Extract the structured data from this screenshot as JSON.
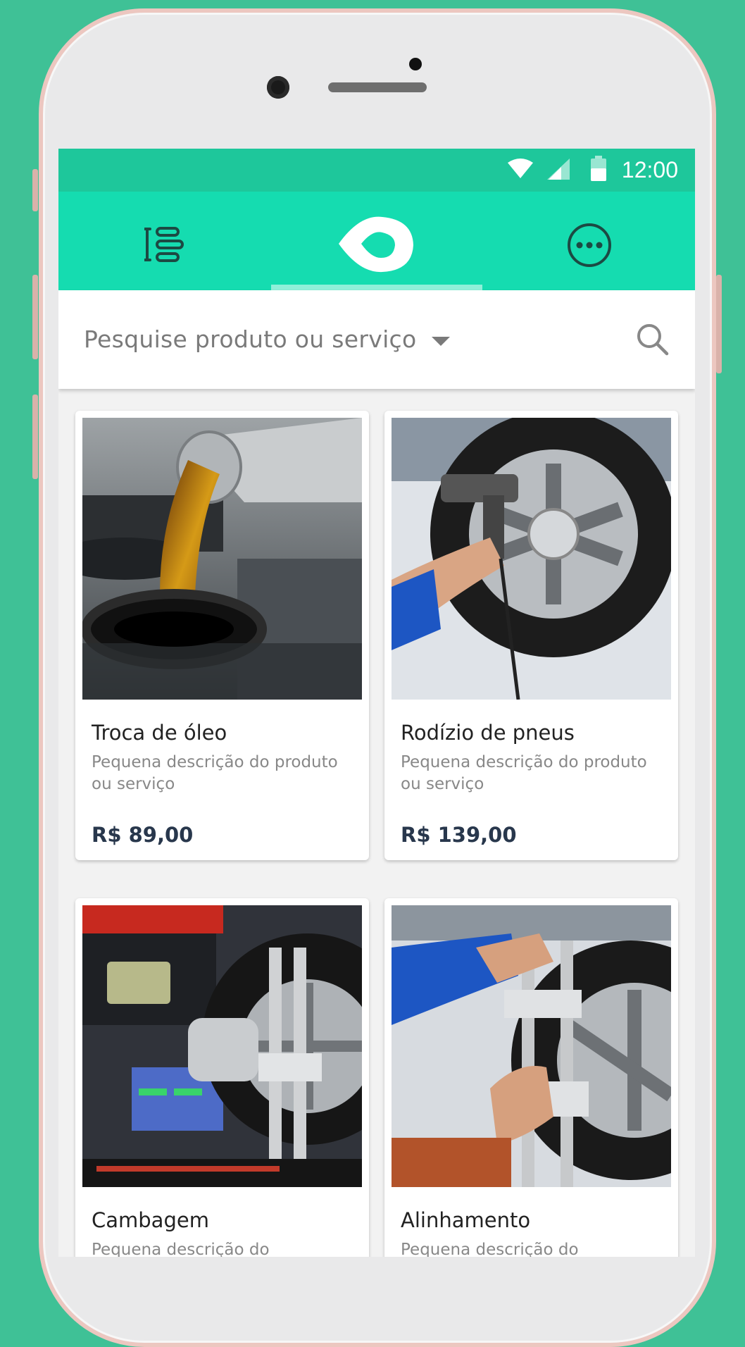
{
  "status_bar": {
    "time": "12:00",
    "icons": [
      "wifi-icon",
      "signal-icon",
      "battery-icon"
    ]
  },
  "app_bar": {
    "icons": [
      "list-menu-icon",
      "logo-drop-icon",
      "more-options-icon"
    ]
  },
  "search": {
    "placeholder": "Pesquise produto ou serviço"
  },
  "products": [
    {
      "title": "Troca de óleo",
      "description": "Pequena descrição do produto ou serviço",
      "price": "R$ 89,00",
      "image": "oil-change-photo"
    },
    {
      "title": "Rodízio de pneus",
      "description": "Pequena descrição do produto ou serviço",
      "price": "R$ 139,00",
      "image": "tire-rotation-photo"
    },
    {
      "title": "Cambagem",
      "description": "Pequena descrição do",
      "image": "camber-photo"
    },
    {
      "title": "Alinhamento",
      "description": "Pequena descrição do",
      "image": "alignment-photo"
    }
  ],
  "colors": {
    "background": "#3fc196",
    "status_bar": "#1ec79b",
    "app_bar": "#15dcb0",
    "tab_indicator": "#8ff0d9",
    "price": "#28374c"
  }
}
